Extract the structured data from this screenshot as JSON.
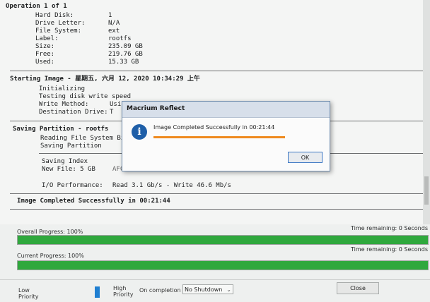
{
  "log": {
    "operation_header": "Operation 1 of 1",
    "disk_info": [
      {
        "key": "Hard Disk:",
        "value": "1"
      },
      {
        "key": "Drive Letter:",
        "value": "N/A"
      },
      {
        "key": "File System:",
        "value": "ext"
      },
      {
        "key": "Label:",
        "value": "rootfs"
      },
      {
        "key": "Size:",
        "value": "235.09 GB"
      },
      {
        "key": "Free:",
        "value": "219.76 GB"
      },
      {
        "key": "Used:",
        "value": "15.33 GB"
      }
    ],
    "starting_image": "Starting Image - 星期五, 六月 12, 2020 10:34:29 上午",
    "init_lines": [
      "Initializing",
      "Testing disk write speed"
    ],
    "write_method_key": "Write Method:",
    "write_method_value": "Usi",
    "destination_key": "Destination Drive:",
    "destination_value": "T",
    "saving_partition": "Saving Partition - rootfs",
    "reading_bitmap": "Reading File System Bit",
    "saving_partition_line": "Saving Partition",
    "saving_index": "Saving Index",
    "new_file": "New File: 5 GB",
    "new_file_tail": "AFC...",
    "io_key": "I/O Performance:",
    "io_value": "Read 3.1 Gb/s - Write 46.6 Mb/s",
    "completed": "Image Completed Successfully in 00:21:44"
  },
  "progress": {
    "overall_label": "Overall Progress:",
    "overall_value": "100%",
    "overall_fraction": 1.0,
    "overall_remaining": "Time remaining: 0 Seconds",
    "current_label": "Current Progress:",
    "current_value": "100%",
    "current_fraction": 1.0,
    "current_remaining": "Time remaining: 0 Seconds"
  },
  "bottom": {
    "low_priority": "Low\nPriority",
    "high_priority": "High\nPriority",
    "on_completion_label": "On completion",
    "on_completion_value": "No Shutdown",
    "close_label": "Close"
  },
  "dialog": {
    "title": "Macrium Reflect",
    "message": "Image Completed Successfully in 00:21:44",
    "ok_label": "OK",
    "progress_fraction": 1.0
  },
  "colors": {
    "progress_green": "#2fa83d",
    "dialog_accent": "#ef8a1f",
    "info_blue": "#1f5fa8"
  }
}
